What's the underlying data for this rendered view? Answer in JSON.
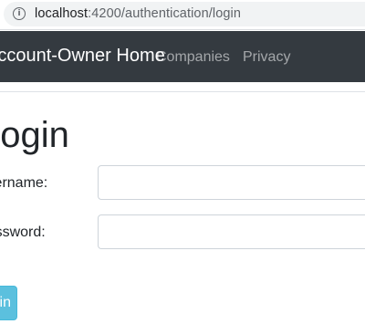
{
  "browser": {
    "url_host": "localhost",
    "url_path": ":4200/authentication/login",
    "info_icon": "info-icon"
  },
  "navbar": {
    "brand": "Account-Owner Home",
    "links": [
      "Companies",
      "Privacy"
    ]
  },
  "login_form": {
    "title": "Login",
    "username_label": "Username:",
    "password_label": "Password:",
    "username_value": "",
    "password_value": "",
    "submit_label": "Login"
  },
  "colors": {
    "navbar_bg": "#343a40",
    "button_bg": "#5bc0de"
  }
}
